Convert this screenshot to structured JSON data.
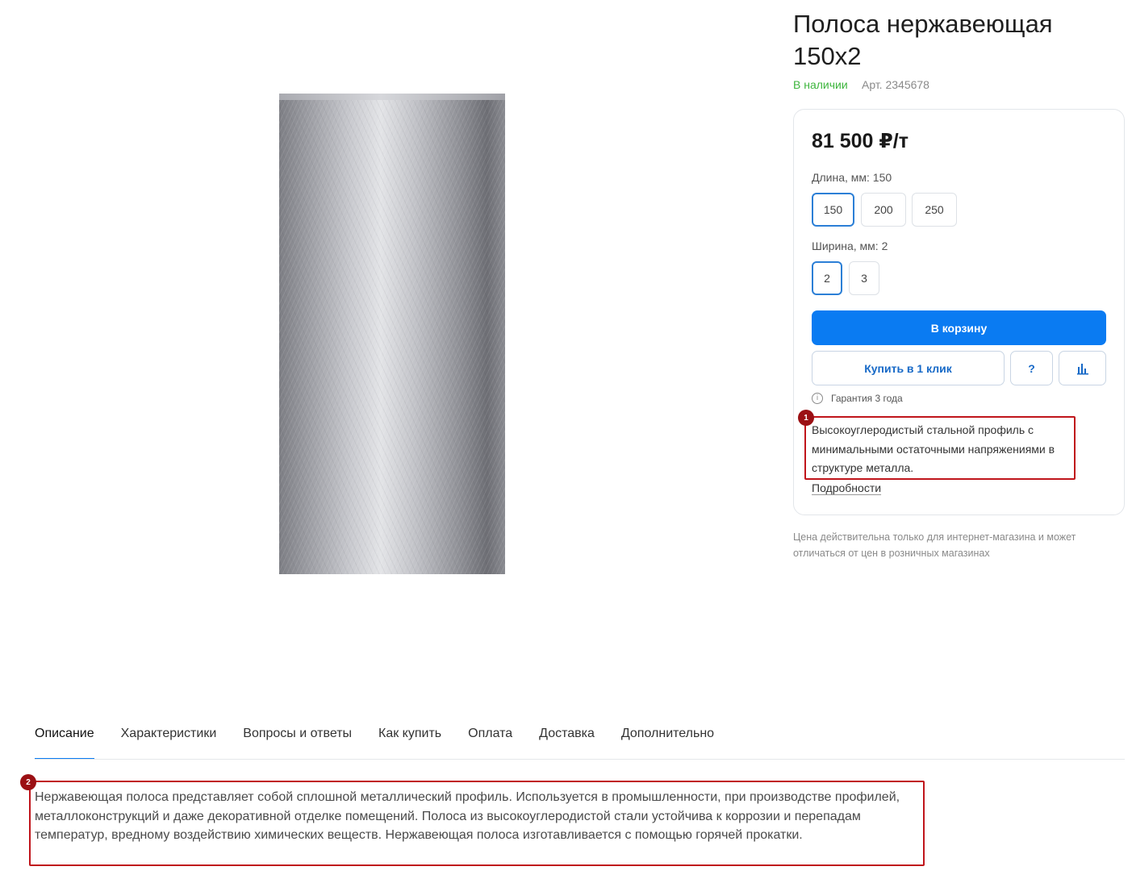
{
  "product": {
    "title": "Полоса нержавеющая 150х2",
    "stock": "В наличии",
    "sku": "Арт. 2345678",
    "image_alt": "Полоса нержавеющая"
  },
  "buy_card": {
    "price": "81 500 ₽/т",
    "length_label": "Длина, мм: 150",
    "length_options": [
      "150",
      "200",
      "250"
    ],
    "length_selected": "150",
    "width_label": "Ширина, мм: 2",
    "width_options": [
      "2",
      "3"
    ],
    "width_selected": "2",
    "cart_button": "В корзину",
    "one_click_button": "Купить в 1 клик",
    "question_button": "?",
    "compare_icon": "bar-chart-icon",
    "info_icon": "info-icon",
    "warranty": "Гарантия 3 года",
    "short_description": "Высокоуглеродистый стальной профиль с минимальными остаточными напряжениями в структуре металла.",
    "more_link": "Подробности"
  },
  "price_note": "Цена действительна только для интернет-магазина и может отличаться от цен в розничных магазинах",
  "tabs": [
    {
      "label": "Описание",
      "active": true
    },
    {
      "label": "Характеристики",
      "active": false
    },
    {
      "label": "Вопросы и ответы",
      "active": false
    },
    {
      "label": "Как купить",
      "active": false
    },
    {
      "label": "Оплата",
      "active": false
    },
    {
      "label": "Доставка",
      "active": false
    },
    {
      "label": "Дополнительно",
      "active": false
    }
  ],
  "description": "Нержавеющая полоса представляет собой сплошной металлический профиль. Используется в промышленности, при производстве профилей, металлоконструкций и даже декоративной отделке помещений. Полоса из высокоуглеродистой стали устойчива к коррозии и перепадам температур, вредному воздействию химических веществ. Нержавеющая полоса изготавливается с помощью горячей прокатки.",
  "annotations": [
    {
      "number": "1"
    },
    {
      "number": "2"
    }
  ],
  "colors": {
    "accent": "#0a7bf2",
    "in_stock": "#3db53d",
    "annotation": "#c0151b"
  }
}
